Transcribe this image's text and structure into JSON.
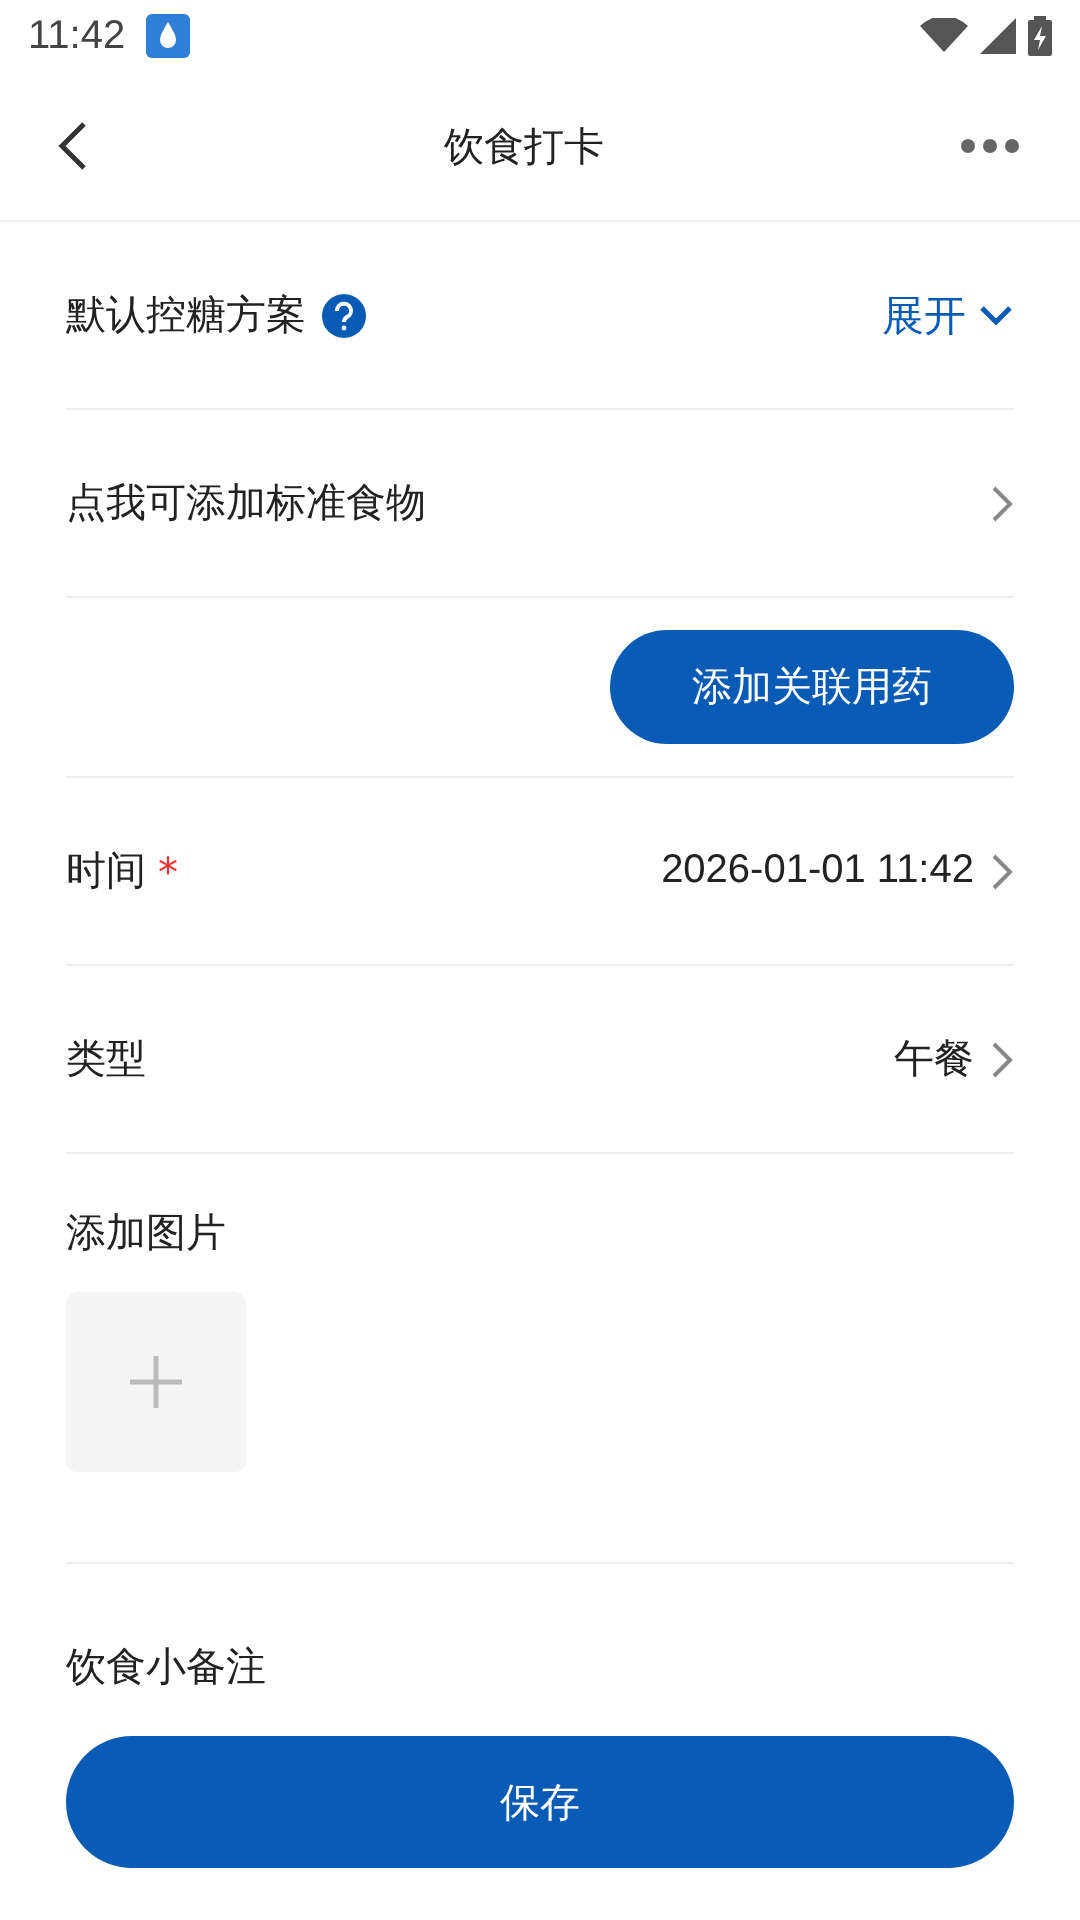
{
  "status_bar": {
    "time": "11:42"
  },
  "header": {
    "title": "饮食打卡"
  },
  "plan_row": {
    "label": "默认控糖方案",
    "action": "展开",
    "expanded": false
  },
  "food_row": {
    "label": "点我可添加标准食物"
  },
  "medication_button": {
    "label": "添加关联用药"
  },
  "required_mark": "*",
  "fields": [
    {
      "label": "时间",
      "required": true,
      "value": "2026-01-01 11:42"
    },
    {
      "label": "类型",
      "required": false,
      "value": "午餐"
    }
  ],
  "photos": {
    "label": "添加图片"
  },
  "note": {
    "label": "饮食小备注"
  },
  "save_button": {
    "label": "保存"
  }
}
